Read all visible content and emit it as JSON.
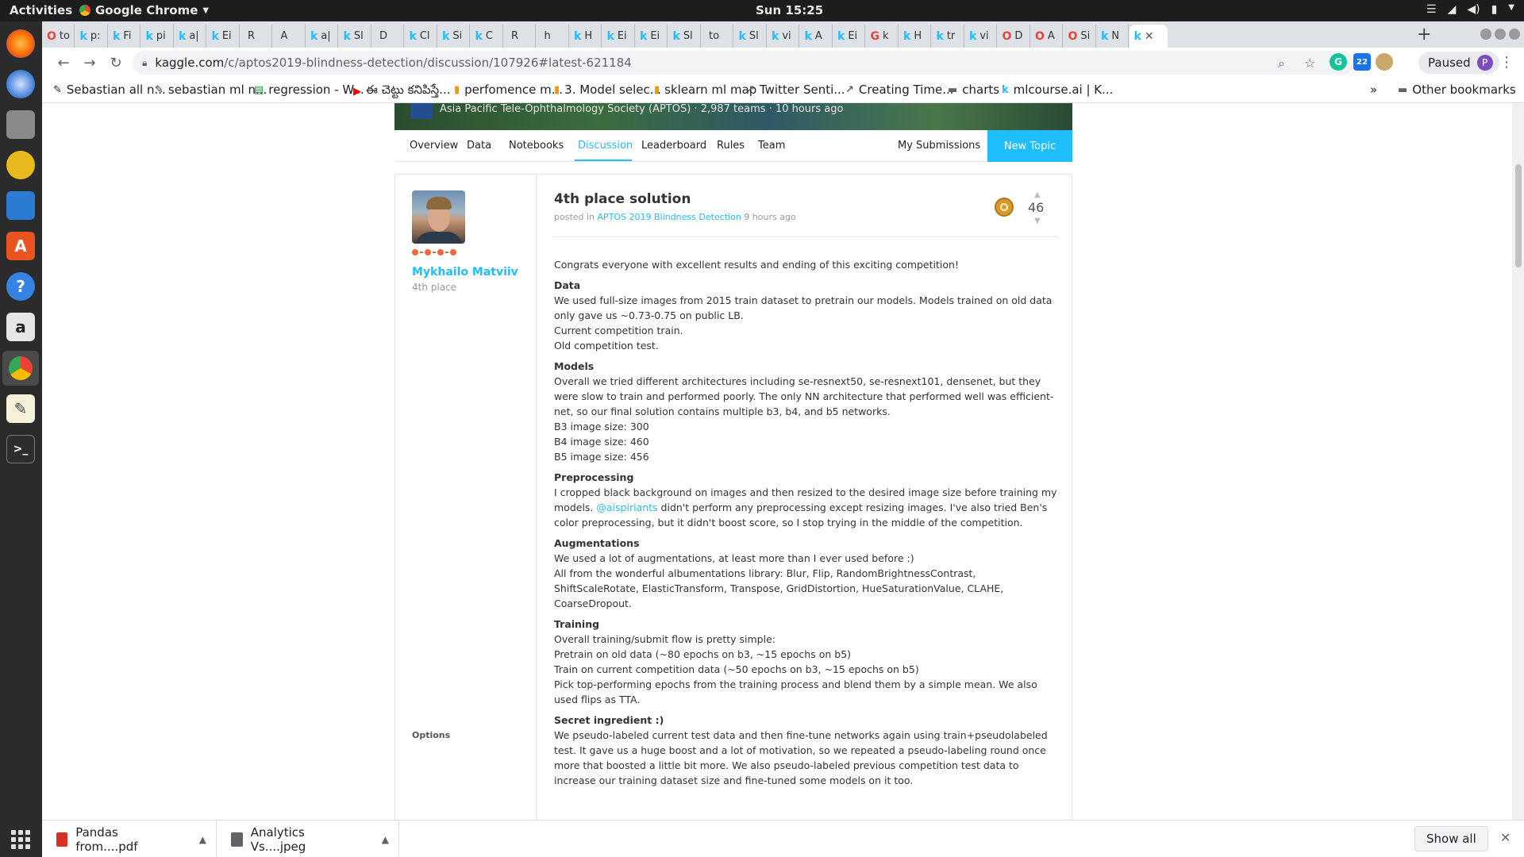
{
  "system": {
    "activities": "Activities",
    "app_name": "Google Chrome",
    "clock": "Sun 15:25"
  },
  "tabs": [
    {
      "icon": "O",
      "title": "to",
      "color": "#e8453c"
    },
    {
      "icon": "k",
      "title": "p:",
      "color": "#20beff"
    },
    {
      "icon": "k",
      "title": "Fi",
      "color": "#20beff"
    },
    {
      "icon": "k",
      "title": "pi",
      "color": "#20beff"
    },
    {
      "icon": "k",
      "title": "a|",
      "color": "#20beff"
    },
    {
      "icon": "k",
      "title": "Ei",
      "color": "#20beff"
    },
    {
      "icon": "",
      "title": "R",
      "color": "#333"
    },
    {
      "icon": "",
      "title": "A",
      "color": "#333"
    },
    {
      "icon": "k",
      "title": "a|",
      "color": "#20beff"
    },
    {
      "icon": "k",
      "title": "Sl",
      "color": "#20beff"
    },
    {
      "icon": "",
      "title": "D",
      "color": "#333"
    },
    {
      "icon": "k",
      "title": "Cl",
      "color": "#20beff"
    },
    {
      "icon": "k",
      "title": "Si",
      "color": "#20beff"
    },
    {
      "icon": "k",
      "title": "C",
      "color": "#20beff"
    },
    {
      "icon": "",
      "title": "R",
      "color": "#333"
    },
    {
      "icon": "",
      "title": "h",
      "color": "#333"
    },
    {
      "icon": "k",
      "title": "H",
      "color": "#20beff"
    },
    {
      "icon": "k",
      "title": "Ei",
      "color": "#20beff"
    },
    {
      "icon": "k",
      "title": "Ei",
      "color": "#20beff"
    },
    {
      "icon": "k",
      "title": "Sl",
      "color": "#20beff"
    },
    {
      "icon": "",
      "title": "to",
      "color": "#333"
    },
    {
      "icon": "k",
      "title": "Sl",
      "color": "#20beff"
    },
    {
      "icon": "k",
      "title": "vi",
      "color": "#20beff"
    },
    {
      "icon": "k",
      "title": "A",
      "color": "#20beff"
    },
    {
      "icon": "k",
      "title": "Ei",
      "color": "#20beff"
    },
    {
      "icon": "G",
      "title": "k",
      "color": "#e8453c"
    },
    {
      "icon": "k",
      "title": "H",
      "color": "#20beff"
    },
    {
      "icon": "k",
      "title": "tr",
      "color": "#20beff"
    },
    {
      "icon": "k",
      "title": "vi",
      "color": "#20beff"
    },
    {
      "icon": "O",
      "title": "D",
      "color": "#e8453c"
    },
    {
      "icon": "O",
      "title": "A",
      "color": "#e8453c"
    },
    {
      "icon": "O",
      "title": "Si",
      "color": "#e8453c"
    },
    {
      "icon": "k",
      "title": "N",
      "color": "#20beff"
    }
  ],
  "active_tab": {
    "icon": "k",
    "close": "✕"
  },
  "address": {
    "host": "kaggle.com",
    "path": "/c/aptos2019-blindness-detection/discussion/107926#latest-621184"
  },
  "profile": {
    "label": "Paused",
    "initial": "P"
  },
  "extension_badge": "22",
  "bookmarks": [
    {
      "icon": "✎",
      "label": "Sebastian all n..."
    },
    {
      "icon": "✎",
      "label": "sebastian ml n..."
    },
    {
      "icon": "▤",
      "label": "regression - W..."
    },
    {
      "icon": "▶",
      "label": "ఈ చెట్టు కనిపిస్తే..."
    },
    {
      "icon": "▮",
      "label": "perfomence m..."
    },
    {
      "icon": "▮",
      "label": "3. Model selec..."
    },
    {
      "icon": "▮",
      "label": "sklearn ml map"
    },
    {
      "icon": "↗",
      "label": "Twitter Senti..."
    },
    {
      "icon": "↗",
      "label": "Creating Time..."
    },
    {
      "icon": "▬",
      "label": "charts"
    },
    {
      "icon": "k",
      "label": "mlcourse.ai | K..."
    }
  ],
  "bookmarks_more": "»",
  "other_bookmarks": "Other bookmarks",
  "banner": {
    "org": "Asia Pacific Tele-Ophthalmology Society (APTOS) · 2,987 teams · 10 hours ago"
  },
  "competition_nav": {
    "tabs": [
      "Overview",
      "Data",
      "Notebooks",
      "Discussion",
      "Leaderboard",
      "Rules",
      "Team"
    ],
    "active": "Discussion",
    "my_submissions": "My Submissions",
    "new_topic": "New Topic"
  },
  "post": {
    "author": "Mykhailo Matviiv",
    "author_rank": "4th place",
    "title": "4th place solution",
    "meta_prefix": "posted in",
    "meta_link": "APTOS 2019 Blindness Detection",
    "meta_time": "9 hours ago",
    "votes": "46",
    "options": "Options",
    "intro": "Congrats everyone with excellent results and ending of this exciting competition!",
    "data_heading": "Data",
    "data_lines": [
      "We used full-size images from 2015 train dataset to pretrain our models. Models trained on old data only gave us ~0.73-0.75 on public LB.",
      "Current competition train.",
      "Old competition test."
    ],
    "models_heading": "Models",
    "models_lines": [
      "Overall we tried different architectures including se-resnext50, se-resnext101, densenet, but they were slow to train and performed poorly. The only NN architecture that performed well was efficient-net, so our final solution contains multiple b3, b4, and b5 networks.",
      "B3 image size: 300",
      "B4 image size: 460",
      "B5 image size: 456"
    ],
    "preprocessing_heading": "Preprocessing",
    "preprocessing_a": "I cropped black background on images and then resized to the desired image size before training my models. ",
    "preprocessing_mention": "@aispiriants",
    "preprocessing_b": " didn't perform any preprocessing except resizing images. I've also tried Ben's color preprocessing, but it didn't boost score, so I stop trying in the middle of the competition.",
    "augmentations_heading": "Augmentations",
    "augmentations_lines": [
      "We used a lot of augmentations, at least more than I ever used before :)",
      "All from the wonderful albumentations library: Blur, Flip, RandomBrightnessContrast, ShiftScaleRotate, ElasticTransform, Transpose, GridDistortion, HueSaturationValue, CLAHE, CoarseDropout."
    ],
    "training_heading": "Training",
    "training_lines": [
      "Overall training/submit flow is pretty simple:",
      "Pretrain on old data (~80 epochs on b3, ~15 epochs on b5)",
      "Train on current competition data (~50 epochs on b3, ~15 epochs on b5)",
      "Pick top-performing epochs from the training process and blend them by a simple mean. We also used flips as TTA."
    ],
    "secret_heading": "Secret ingredient :)",
    "secret_text": "We pseudo-labeled current test data and then fine-tune networks again using train+pseudolabeled test. It gave us a huge boost and a lot of motivation, so we repeated a pseudo-labeling round once more that boosted a little bit more. We also pseudo-labeled previous competition test data to increase our training dataset size and fine-tuned some models on it too."
  },
  "downloads": [
    {
      "name": "Pandas from....pdf",
      "color": "#d93025"
    },
    {
      "name": "Analytics Vs....jpeg",
      "color": "#5f6368"
    }
  ],
  "show_all": "Show all",
  "colors": {
    "kaggle_blue": "#20beff",
    "tier_orange": "#f1683a",
    "medal_gold": "#d79a2a"
  }
}
